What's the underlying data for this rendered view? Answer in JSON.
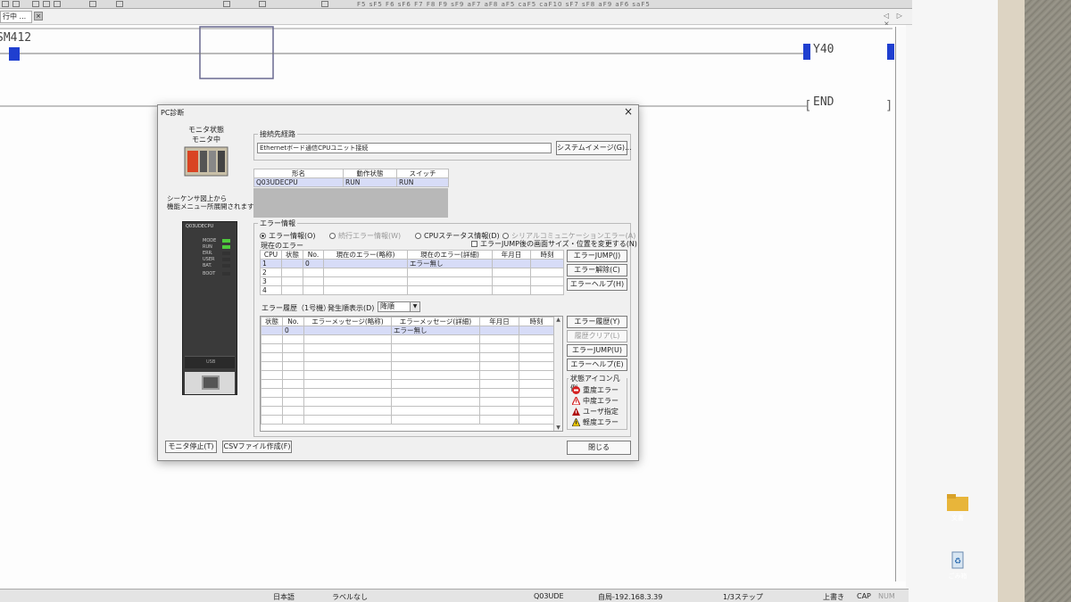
{
  "app": {
    "tab_label": "行中 ...",
    "tab_close": "×",
    "toolbar_strip": "F5 sF5 F6 sF6 F7 F8 F9 sF9 aF7 aF8 aF5 caF5 caF10 sF7 sF8 aF9 aF6 saF5",
    "tab_arrows": "◁ ▷ ×"
  },
  "ladder": {
    "contact_label": "SM412",
    "coil_label": "Y40",
    "end_label": "END"
  },
  "status_bar": {
    "language": "日本語",
    "label": "ラベルなし",
    "cpu": "Q03UDE",
    "connection": "自局-192.168.3.39",
    "steps": "1/3ステップ",
    "mode": "上書き",
    "caps": "CAP",
    "num": "NUM"
  },
  "desktop": {
    "folder_label": "文書",
    "recycle_label": "ごみ箱"
  },
  "dialog": {
    "title": "PC診断",
    "close": "×",
    "monitor_state_label": "モニタ状態",
    "monitor_state_value": "モニタ中",
    "hint_text_line1": "シーケンサ図上から",
    "hint_text_line2": "機能メニュー所展開されます。",
    "connection_group": "接続先経路",
    "connection_value": "Ethernetボード通信CPUユニット接続",
    "system_image_button": "システムイメージ(G)...",
    "module_table": {
      "headers": [
        "形名",
        "動作状態",
        "スイッチ"
      ],
      "row": [
        "Q03UDECPU",
        "RUN",
        "RUN"
      ]
    },
    "error_group": "エラー情報",
    "radios": [
      {
        "label": "エラー情報(O)",
        "checked": true,
        "disabled": false
      },
      {
        "label": "続行エラー情報(W)",
        "checked": false,
        "disabled": true
      },
      {
        "label": "CPUステータス情報(D)",
        "checked": false,
        "disabled": false
      },
      {
        "label": "シリアルコミュニケーションエラー(A)",
        "checked": false,
        "disabled": true
      }
    ],
    "jump_checkbox": "エラーJUMP後の画面サイズ・位置を変更する(N)",
    "current_error_label": "現在のエラー",
    "current_table": {
      "headers": [
        "CPU",
        "状態",
        "No.",
        "現在のエラー(略称)",
        "現在のエラー(詳細)",
        "年月日",
        "時刻"
      ],
      "rows": [
        [
          "1",
          "",
          "0",
          "",
          "エラー無し",
          "",
          ""
        ],
        [
          "2",
          "",
          "",
          "",
          "",
          "",
          ""
        ],
        [
          "3",
          "",
          "",
          "",
          "",
          "",
          ""
        ],
        [
          "4",
          "",
          "",
          "",
          "",
          "",
          ""
        ]
      ]
    },
    "current_buttons": [
      "エラーJUMP(J)",
      "エラー解除(C)",
      "エラーヘルプ(H)"
    ],
    "history_label": "エラー履歴（1号機）",
    "order_label": "発生順表示(D)",
    "order_value": "降順",
    "history_table": {
      "headers": [
        "状態",
        "No.",
        "エラーメッセージ(略称)",
        "エラーメッセージ(詳細)",
        "年月日",
        "時刻"
      ],
      "first_row": [
        "",
        "0",
        "",
        "エラー無し",
        "",
        ""
      ]
    },
    "history_buttons": [
      {
        "label": "エラー履歴(Y)",
        "disabled": false
      },
      {
        "label": "履歴クリア(L)",
        "disabled": true
      },
      {
        "label": "エラーJUMP(U)",
        "disabled": false
      },
      {
        "label": "エラーヘルプ(E)",
        "disabled": false
      }
    ],
    "legend_title": "状態アイコン凡例",
    "legend": [
      {
        "label": "重度エラー",
        "icon": "stop-icon",
        "color": "#d42020"
      },
      {
        "label": "中度エラー",
        "icon": "warning-icon",
        "color": "#d42020"
      },
      {
        "label": "ユーザ指定",
        "icon": "warning-icon",
        "color": "#b01010"
      },
      {
        "label": "軽度エラー",
        "icon": "warning-icon",
        "color": "#f0c800"
      }
    ],
    "stop_monitor_button": "モニタ停止(T)",
    "csv_button": "CSVファイル作成(F)",
    "close_button": "閉じる",
    "plc_model": "Q03UDECPU",
    "plc_leds": [
      "MODE",
      "RUN",
      "ERR.",
      "USER",
      "BAT.",
      "BOOT"
    ],
    "plc_usb": "USB"
  }
}
